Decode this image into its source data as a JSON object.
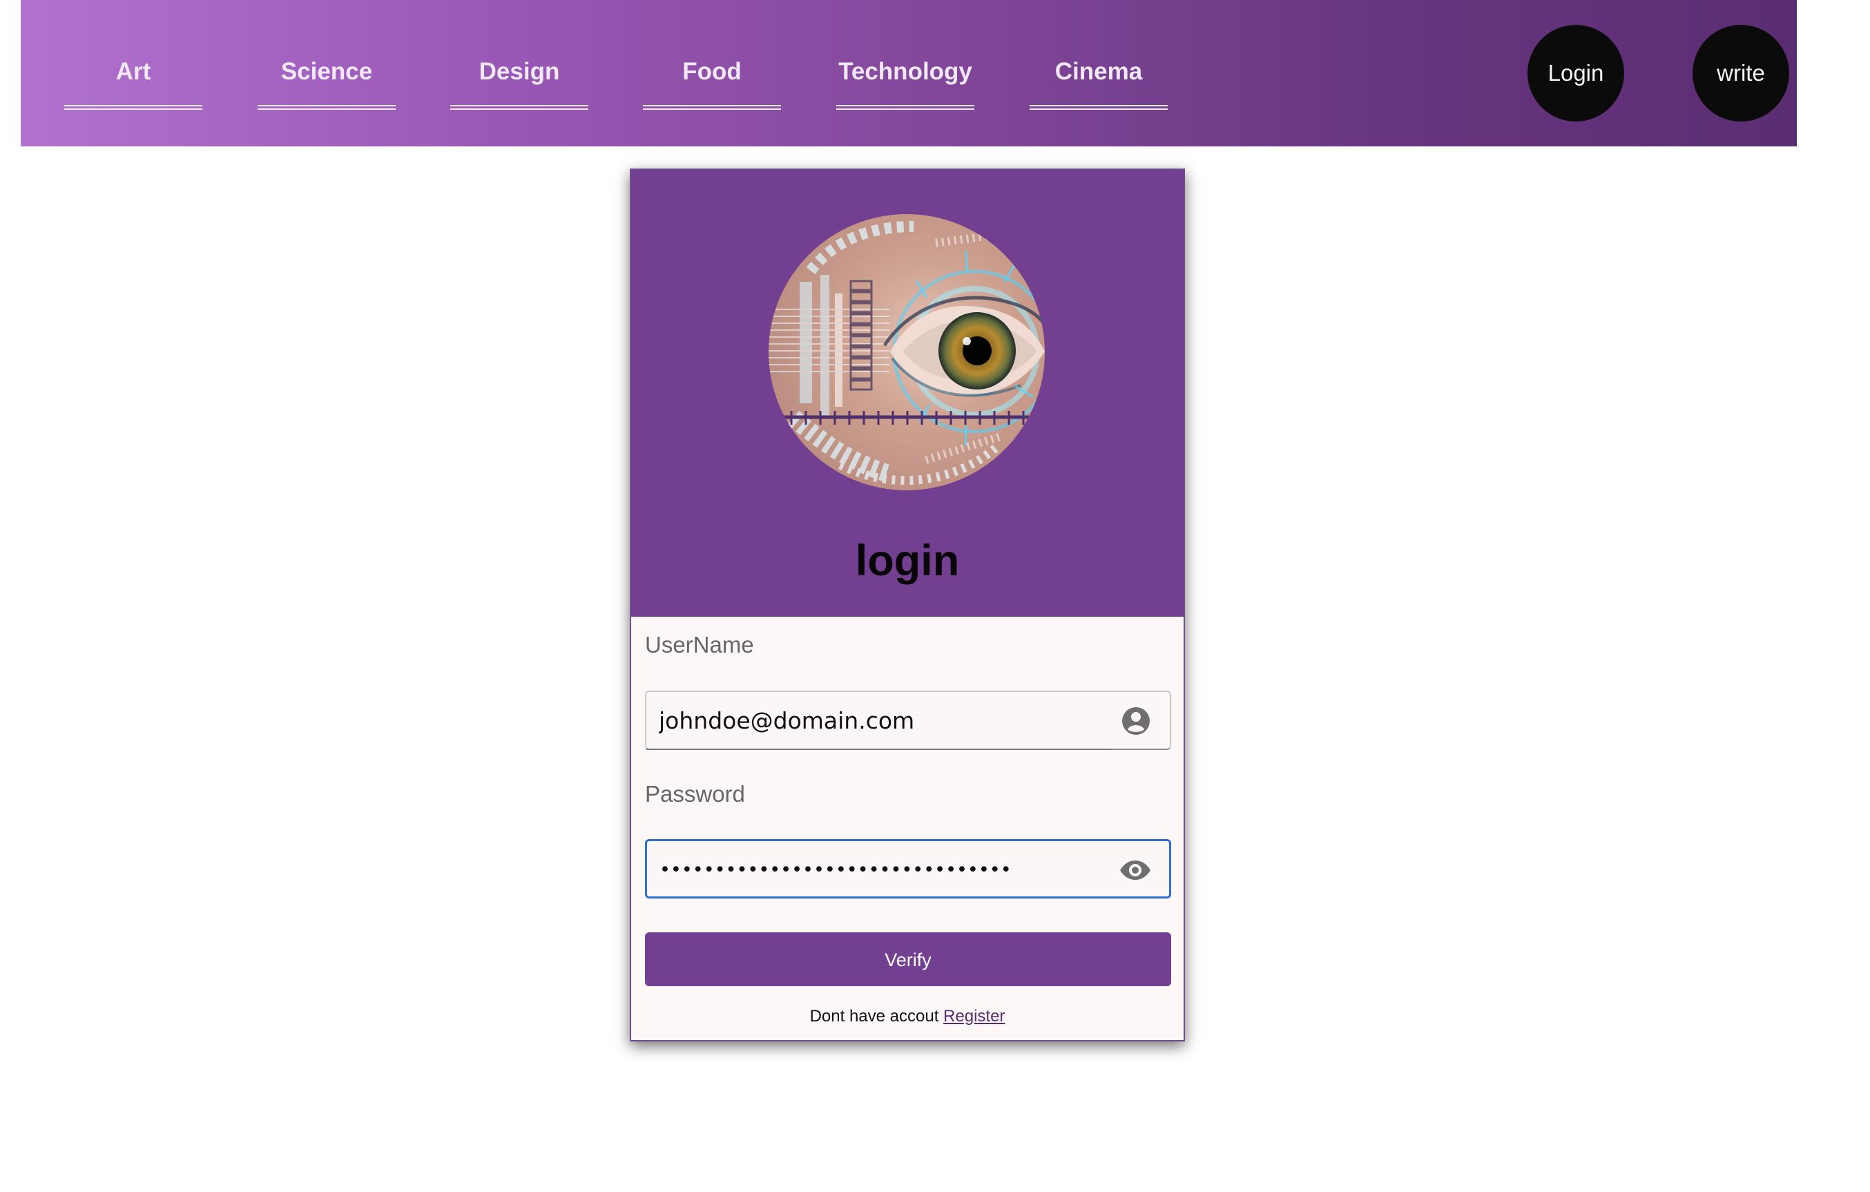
{
  "navigation": {
    "items": [
      {
        "label": "Art"
      },
      {
        "label": "Science"
      },
      {
        "label": "Design"
      },
      {
        "label": "Food"
      },
      {
        "label": "Technology"
      },
      {
        "label": "Cinema"
      }
    ],
    "actions": {
      "login_label": "Login",
      "write_label": "write"
    }
  },
  "login_card": {
    "title": "login",
    "username": {
      "label": "UserName",
      "value": "johndoe@domain.com"
    },
    "password": {
      "label": "Password",
      "value": "••••••••••••••••••••••••••••••••"
    },
    "verify_label": "Verify",
    "register_prompt": "Dont have accout",
    "register_link": "Register"
  },
  "icons": {
    "user": "account-circle-icon",
    "visibility": "eye-icon"
  },
  "colors": {
    "nav_gradient_start": "#b171cf",
    "nav_gradient_end": "#5a2d72",
    "card_purple": "#733f90",
    "focus_blue": "#2f6ed3",
    "button_black": "#0b0b0b"
  }
}
